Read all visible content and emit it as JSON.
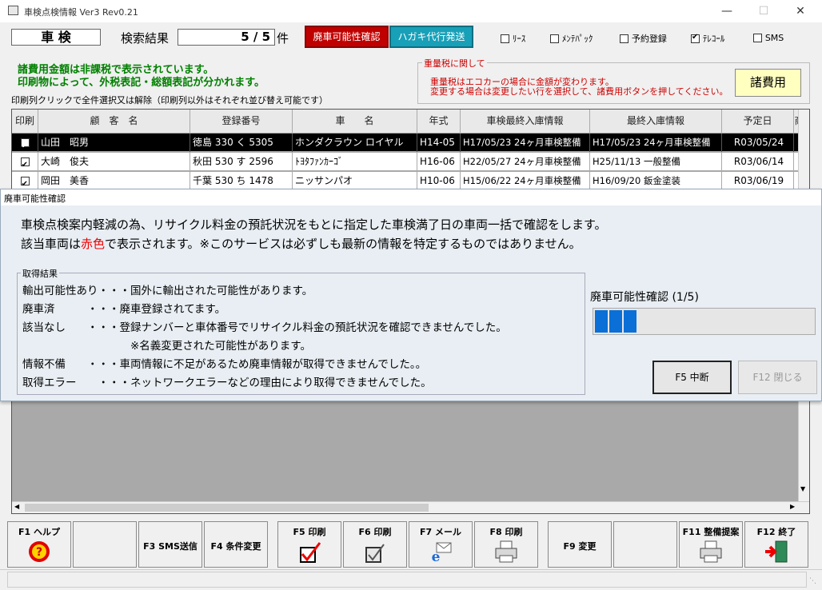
{
  "window": {
    "title": "車検点検情報 Ver3 Rev0.21"
  },
  "header": {
    "title": "車 検",
    "search_label": "検索結果",
    "count": "5 / 5",
    "count_unit": "件",
    "btn_haisha": "廃車可能性確認",
    "btn_hagaki": "ハガキ代行発送",
    "checkboxes": [
      {
        "label": "ﾘｰｽ",
        "checked": false
      },
      {
        "label": "ﾒﾝﾃﾊﾟｯｸ",
        "checked": false
      },
      {
        "label": "予約登録",
        "checked": false
      },
      {
        "label": "ﾃﾚｺｰﾙ",
        "checked": true
      },
      {
        "label": "SMS",
        "checked": false
      }
    ]
  },
  "notice": {
    "line1": "諸費用金額は非課税で表示されています。",
    "line2": "印刷物によって、外税表記・総額表記が分かれます。",
    "print_hint": "印刷列クリックで全件選択又は解除（印刷列以外はそれぞれ並び替え可能です）"
  },
  "weight_tax": {
    "legend": "重量税に関して",
    "line1": "重量税はエコカーの場合に金額が変わります。",
    "line2": "変更する場合は変更したい行を選択して、諸費用ボタンを押してください。",
    "button": "諸費用"
  },
  "table": {
    "headers": [
      "印刷",
      "顧　客　名",
      "登録番号",
      "車　　名",
      "年式",
      "車検最終入庫情報",
      "最終入庫情報",
      "予定日",
      "商"
    ],
    "rows": [
      {
        "print": true,
        "name": "山田　昭男",
        "reg": "徳島 330 く 5305",
        "car": "ホンダクラウン ロイヤル",
        "year": "H14-05",
        "inspection": "H17/05/23 24ヶ月車検整備",
        "last": "H17/05/23 24ヶ月車検整備",
        "date": "R03/05/24"
      },
      {
        "print": true,
        "name": "大崎　俊夫",
        "reg": "秋田 530 す 2596",
        "car": "ﾄﾖﾀﾌｧﾝｶｰｺﾞ",
        "year": "H16-06",
        "inspection": "H22/05/27 24ヶ月車検整備",
        "last": "H25/11/13 一般整備",
        "date": "R03/06/14"
      },
      {
        "print": true,
        "name": "岡田　美香",
        "reg": "千葉 530 ち 1478",
        "car": "ニッサンパオ",
        "year": "H10-06",
        "inspection": "H15/06/22 24ヶ月車検整備",
        "last": "H16/09/20 鈑金塗装",
        "date": "R03/06/19"
      }
    ]
  },
  "dialog": {
    "title": "廃車可能性確認",
    "line1": "車検点検案内軽減の為、リサイクル料金の預託状況をもとに指定した車検満了日の車両一括で確認をします。",
    "line2_pre": "該当車両は",
    "line2_red": "赤色",
    "line2_post": "で表示されます。※このサービスは必ずしも最新の情報を特定するものではありません。",
    "results_legend": "取得結果",
    "results": [
      "輸出可能性あり・・・国外に輸出された可能性があります。",
      "廃車済　　　・・・廃車登録されてます。",
      "該当なし　　・・・登録ナンバーと車体番号でリサイクル料金の預託状況を確認できませんでした。",
      "　　　　　　　　　　※名義変更された可能性があります。",
      "情報不備　　・・・車両情報に不足があるため廃車情報が取得できませんでした。。",
      "取得エラー　　・・・ネットワークエラーなどの理由により取得できませんでした。"
    ],
    "progress_label": "廃車可能性確認",
    "progress_count": "(1/5)",
    "progress_fraction": 0.2,
    "btn_stop": "F5 中断",
    "btn_close": "F12 閉じる"
  },
  "fkeys": [
    {
      "label": "F1 ヘルプ",
      "icon": "help-icon"
    },
    {
      "label": "",
      "icon": ""
    },
    {
      "label": "F3 SMS送信",
      "icon": ""
    },
    {
      "label": "F4 条件変更",
      "icon": ""
    },
    {
      "label": "F5 印刷",
      "icon": "check-print-icon"
    },
    {
      "label": "F6 印刷",
      "icon": "checkbox-print-icon"
    },
    {
      "label": "F7 メール",
      "icon": "mail-icon"
    },
    {
      "label": "F8 印刷",
      "icon": "printer-icon"
    },
    {
      "label": "F9 変更",
      "icon": ""
    },
    {
      "label": "",
      "icon": ""
    },
    {
      "label": "F11 整備提案",
      "icon": "printer-icon"
    },
    {
      "label": "F12 終了",
      "icon": "exit-icon"
    }
  ]
}
